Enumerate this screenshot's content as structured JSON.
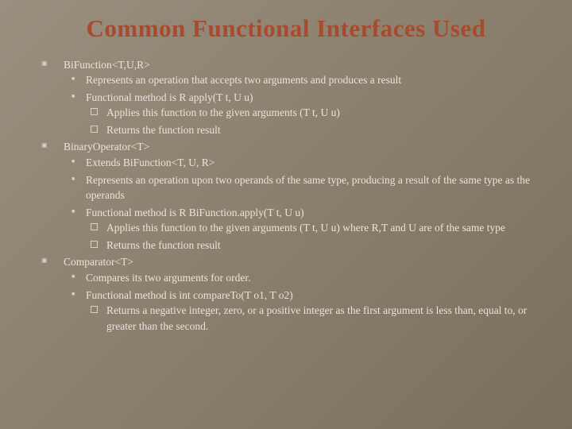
{
  "title": "Common Functional Interfaces Used",
  "items": [
    {
      "label": "BiFunction<T,U,R>",
      "children": [
        {
          "label": "Represents an operation that accepts two arguments and produces a result"
        },
        {
          "label": "Functional method is R apply(T t, U u)",
          "children": [
            {
              "label": "Applies this function to the given arguments (T t, U u)"
            },
            {
              "label": "Returns the function result"
            }
          ]
        }
      ]
    },
    {
      "label": "BinaryOperator<T>",
      "children": [
        {
          "label": "Extends BiFunction<T, U, R>"
        },
        {
          "label": "Represents an operation upon two operands of the same type, producing a result of the same type as the operands"
        },
        {
          "label": "Functional method is R BiFunction.apply(T t, U u)",
          "children": [
            {
              "label": "Applies this function to the given arguments (T t, U u) where R,T and U are of the same type"
            },
            {
              "label": "Returns the function result"
            }
          ]
        }
      ]
    },
    {
      "label": "Comparator<T>",
      "children": [
        {
          "label": "Compares its two arguments  for order."
        },
        {
          "label": "Functional method is int compareTo(T o1, T o2)",
          "children": [
            {
              "label": "Returns a negative integer, zero, or a positive integer as the first argument is less than, equal  to, or greater than the second."
            }
          ]
        }
      ]
    }
  ]
}
